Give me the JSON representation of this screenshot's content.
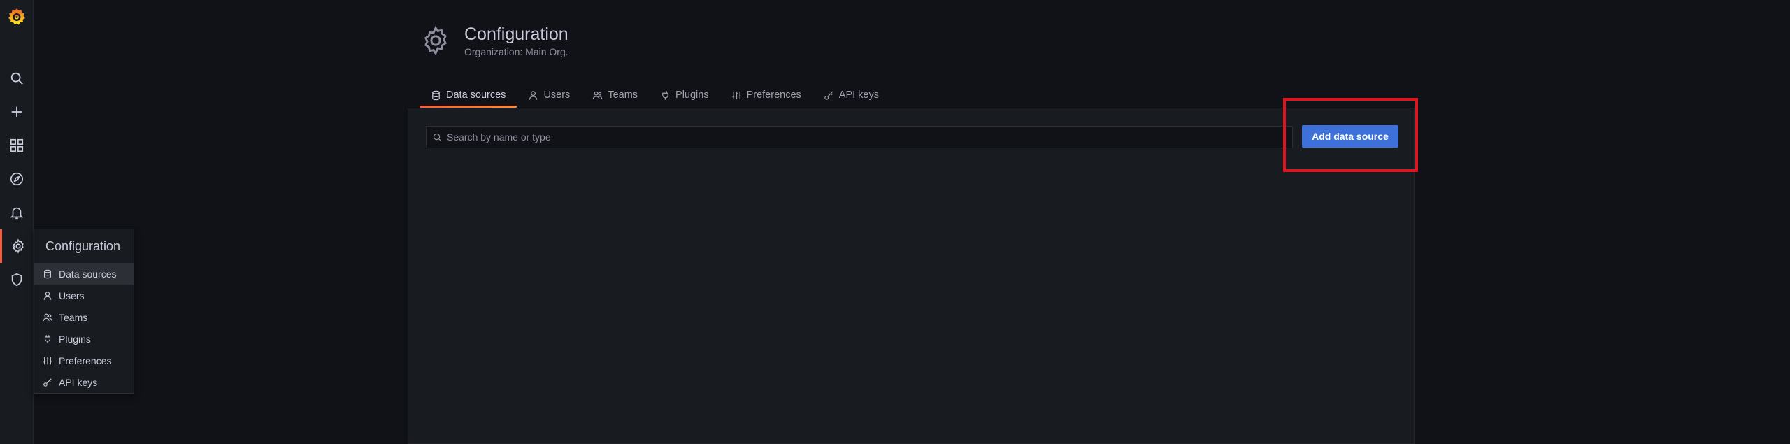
{
  "sidemenu": {
    "logo": "grafana-logo-icon",
    "items": [
      {
        "icon": "search-icon"
      },
      {
        "icon": "plus-icon"
      },
      {
        "icon": "dashboards-icon"
      },
      {
        "icon": "explore-compass-icon"
      },
      {
        "icon": "bell-icon"
      },
      {
        "icon": "gear-icon",
        "active": true
      },
      {
        "icon": "shield-icon"
      }
    ],
    "accent": "#f55f3e"
  },
  "flyout": {
    "title": "Configuration",
    "items": [
      {
        "label": "Data sources",
        "icon": "database-icon",
        "active": true
      },
      {
        "label": "Users",
        "icon": "user-icon"
      },
      {
        "label": "Teams",
        "icon": "users-icon"
      },
      {
        "label": "Plugins",
        "icon": "plug-icon"
      },
      {
        "label": "Preferences",
        "icon": "sliders-icon"
      },
      {
        "label": "API keys",
        "icon": "key-icon"
      }
    ]
  },
  "header": {
    "title": "Configuration",
    "subtitle": "Organization: Main Org.",
    "icon": "gear-icon"
  },
  "tabs": [
    {
      "label": "Data sources",
      "icon": "database-icon",
      "active": true
    },
    {
      "label": "Users",
      "icon": "user-icon"
    },
    {
      "label": "Teams",
      "icon": "users-icon"
    },
    {
      "label": "Plugins",
      "icon": "plug-icon"
    },
    {
      "label": "Preferences",
      "icon": "sliders-icon"
    },
    {
      "label": "API keys",
      "icon": "key-icon"
    }
  ],
  "search": {
    "placeholder": "Search by name or type",
    "value": ""
  },
  "add_button": {
    "label": "Add data source",
    "color": "#3d71d9"
  },
  "highlight_color": "#e0141e"
}
